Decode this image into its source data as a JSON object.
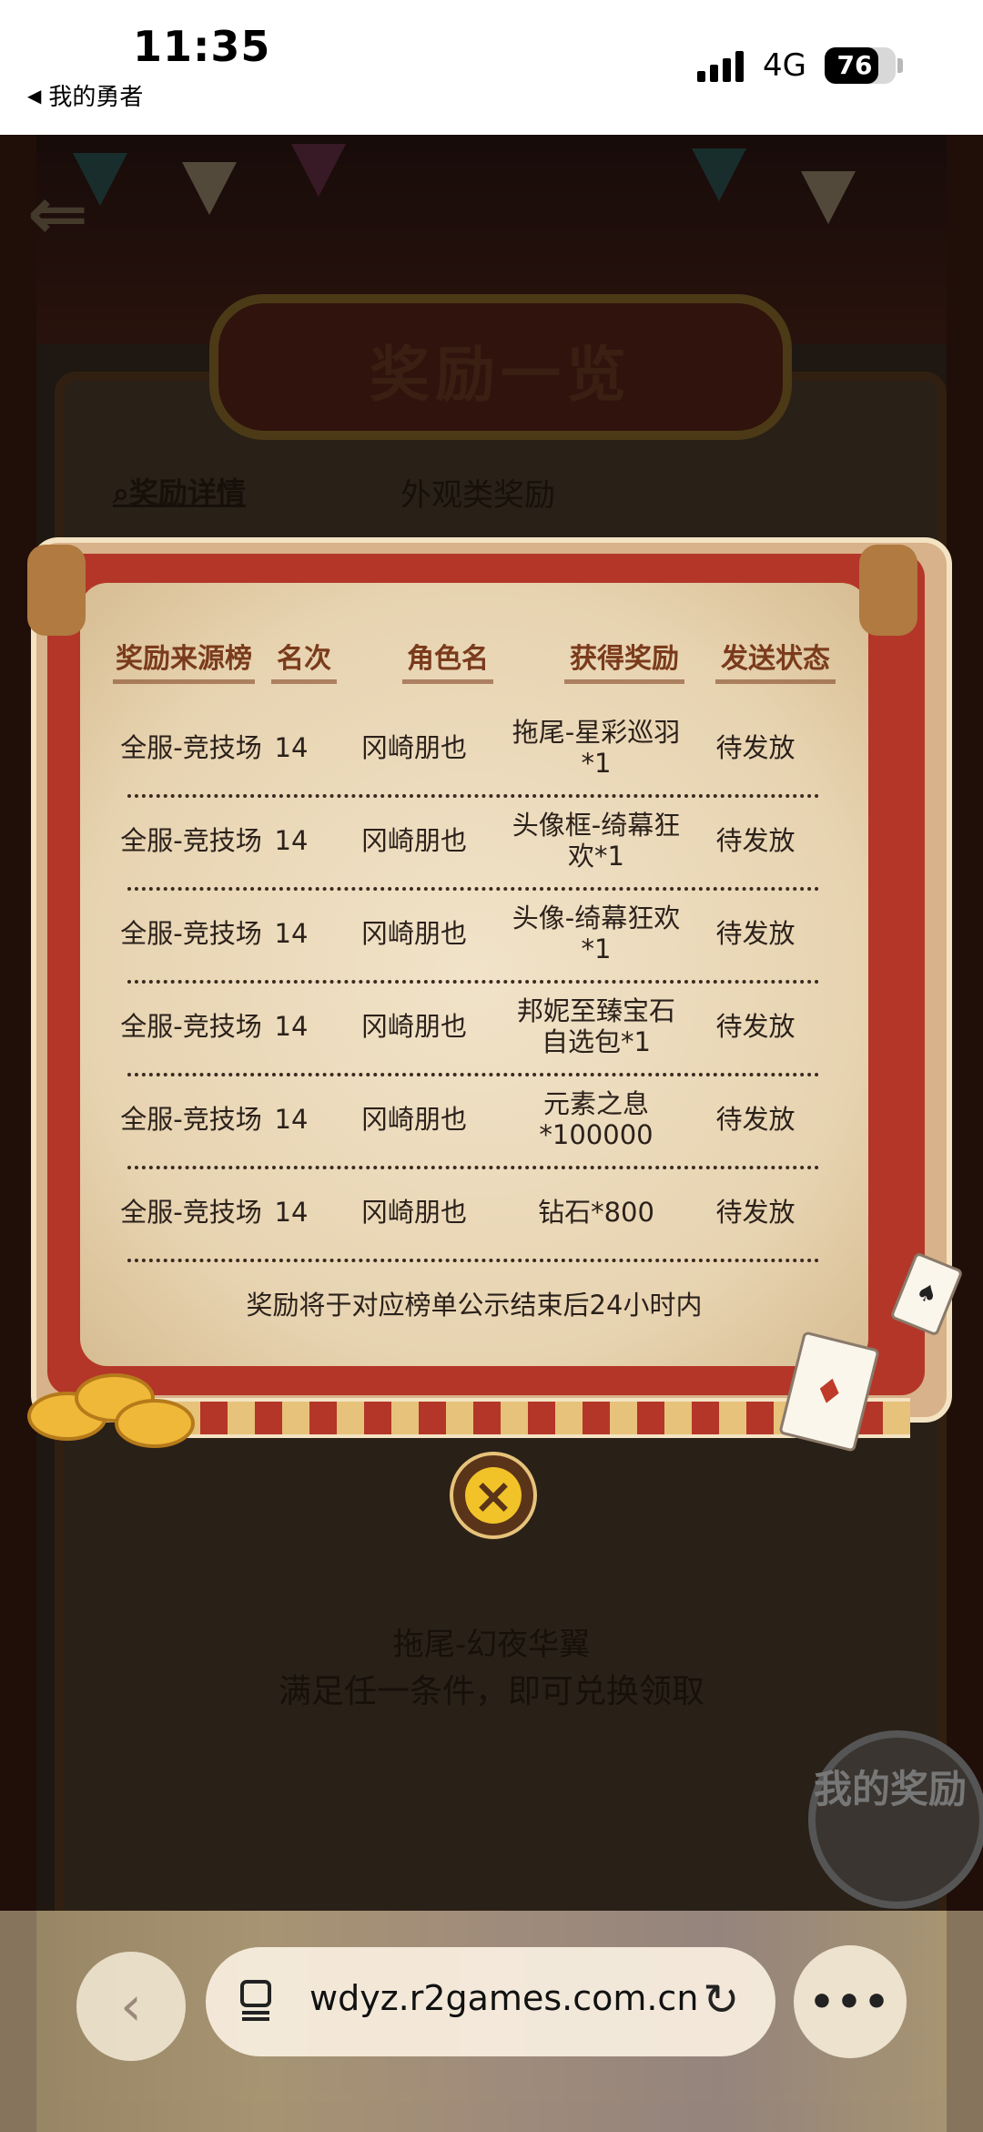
{
  "status_bar": {
    "time": "11:35",
    "back_app": "我的勇者",
    "network": "4G",
    "battery": "76",
    "battery_level_percent": 76
  },
  "game": {
    "banner_title": "奖励一览",
    "detail_link": "奖励详情",
    "category": "外观类奖励",
    "item_name": "拖尾-幻夜华翼",
    "item_condition": "满足任一条件，即可兑换领取",
    "my_reward": "我的奖励"
  },
  "modal": {
    "headers": {
      "source": "奖励来源榜",
      "rank": "名次",
      "name": "角色名",
      "reward": "获得奖励",
      "status": "发送状态"
    },
    "rows": [
      {
        "source": "全服-竞技场",
        "rank": "14",
        "name": "冈崎朋也",
        "reward": "拖尾-星彩巡羽*1",
        "status": "待发放"
      },
      {
        "source": "全服-竞技场",
        "rank": "14",
        "name": "冈崎朋也",
        "reward": "头像框-绮幕狂欢*1",
        "status": "待发放"
      },
      {
        "source": "全服-竞技场",
        "rank": "14",
        "name": "冈崎朋也",
        "reward": "头像-绮幕狂欢*1",
        "status": "待发放"
      },
      {
        "source": "全服-竞技场",
        "rank": "14",
        "name": "冈崎朋也",
        "reward": "邦妮至臻宝石自选包*1",
        "status": "待发放"
      },
      {
        "source": "全服-竞技场",
        "rank": "14",
        "name": "冈崎朋也",
        "reward": "元素之息*100000",
        "status": "待发放"
      },
      {
        "source": "全服-竞技场",
        "rank": "14",
        "name": "冈崎朋也",
        "reward": "钻石*800",
        "status": "待发放"
      }
    ],
    "footnote": "奖励将于对应榜单公示结束后24小时内",
    "close_icon": "×"
  },
  "browser": {
    "url": "wdyz.r2games.com.cn",
    "back_icon": "‹",
    "reload_icon": "↻",
    "more_icon": "•••"
  }
}
